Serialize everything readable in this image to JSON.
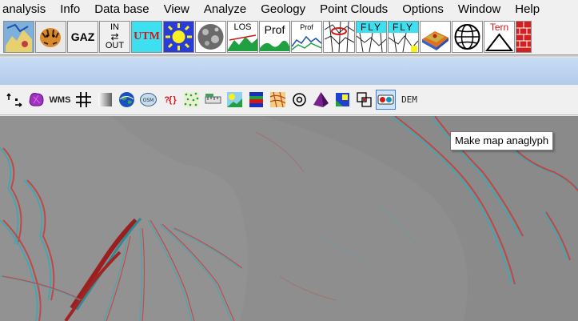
{
  "menubar": {
    "items": [
      "analysis",
      "Info",
      "Data base",
      "View",
      "Analyze",
      "Geology",
      "Point Clouds",
      "Options",
      "Window",
      "Help"
    ]
  },
  "toolbar1": {
    "buttons": [
      {
        "icon": "satellite-image-icon"
      },
      {
        "icon": "tiger-icon"
      },
      {
        "icon": "gazetteer-icon",
        "label": "GAZ"
      },
      {
        "icon": "in-out-icon",
        "label_top": "IN",
        "label_bottom": "OUT"
      },
      {
        "icon": "utm-icon",
        "label": "UTM"
      },
      {
        "icon": "sun-icon"
      },
      {
        "icon": "moon-icon"
      },
      {
        "icon": "los-icon",
        "label": "LOS"
      },
      {
        "icon": "profile-icon",
        "label": "Prof"
      },
      {
        "icon": "small-profile-icon",
        "label": "Prof"
      },
      {
        "icon": "flight-path-icon"
      },
      {
        "icon": "fly-icon",
        "label": "FLY"
      },
      {
        "icon": "fly-icon",
        "label": "FLY"
      },
      {
        "icon": "terrain-3d-icon"
      },
      {
        "icon": "globe-icon"
      },
      {
        "icon": "ternary-icon",
        "label": "Tern"
      },
      {
        "icon": "bricks-icon"
      }
    ]
  },
  "toolbar2": {
    "buttons": [
      {
        "icon": "move-tool-icon"
      },
      {
        "icon": "purple-blob-icon"
      },
      {
        "icon": "wms-icon",
        "label": "WMS"
      },
      {
        "icon": "grid-icon"
      },
      {
        "icon": "gradient-icon"
      },
      {
        "icon": "earth-icon"
      },
      {
        "icon": "openstreetmap-icon"
      },
      {
        "icon": "query-icon",
        "label": "?{ }"
      },
      {
        "icon": "points-icon"
      },
      {
        "icon": "ruler-icon"
      },
      {
        "icon": "sun-map-icon"
      },
      {
        "icon": "color-bands-icon"
      },
      {
        "icon": "geology-map-icon"
      },
      {
        "icon": "target-icon"
      },
      {
        "icon": "pyramid-icon"
      },
      {
        "icon": "shapes-icon"
      },
      {
        "icon": "overlay-icon"
      },
      {
        "icon": "anaglyph-icon"
      },
      {
        "icon": "dem-icon",
        "label": "DEM"
      }
    ]
  },
  "tooltip": {
    "text": "Make map anaglyph"
  },
  "colors": {
    "menubar_bg": "#f0f0f0",
    "bluebar": "#bcd2ee",
    "map_gray": "#8d8d8d",
    "anaglyph_red": "#c83c3c",
    "anaglyph_cyan": "#3ca8b4"
  }
}
